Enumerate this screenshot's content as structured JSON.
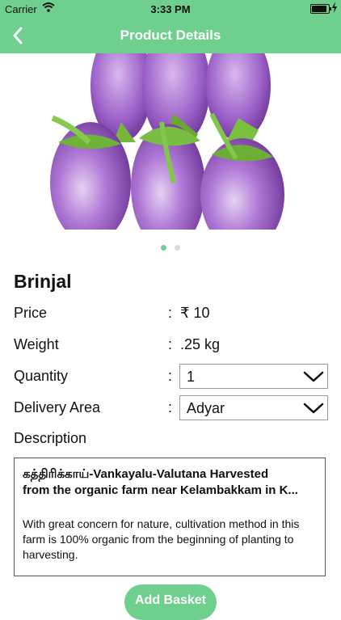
{
  "status_bar": {
    "carrier": "Carrier",
    "time": "3:33 PM"
  },
  "nav": {
    "title": "Product Details"
  },
  "gallery": {
    "dot_count": 2,
    "active_index": 0
  },
  "product": {
    "name": "Brinjal",
    "price_label": "Price",
    "price_value": "₹ 10",
    "weight_label": "Weight",
    "weight_value": ".25 kg",
    "quantity_label": "Quantity",
    "quantity_value": "1",
    "delivery_label": "Delivery Area",
    "delivery_value": "Adyar",
    "colon": ":"
  },
  "description": {
    "label": "Description",
    "heading_line1": "கத்திரிக்காய்-Vankayalu-Valutana Harvested",
    "heading_line2": "from the organic farm near Kelambakkam in K...",
    "body": "With great concern for nature, cultivation method in this farm is 100% organic from the beginning of planting to harvesting."
  },
  "actions": {
    "add_basket": "Add Basket"
  },
  "colors": {
    "brand_green": "#6fcf8e",
    "eggplant_purple": "#b078d6"
  },
  "icons": {
    "back": "chevron-left-icon",
    "dropdown": "chevron-down-icon",
    "wifi": "wifi-icon",
    "battery": "battery-icon"
  }
}
